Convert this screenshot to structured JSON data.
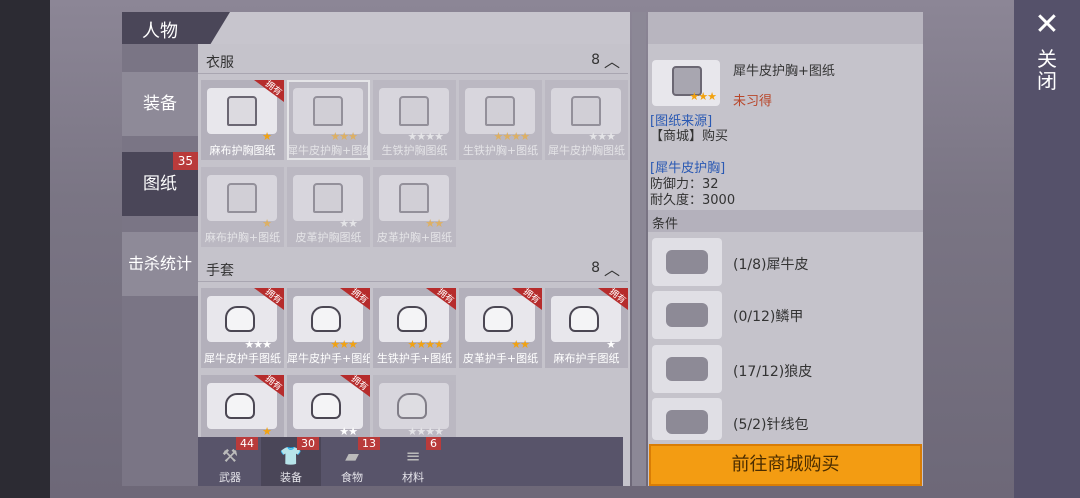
{
  "header": {
    "title": "人物"
  },
  "close": {
    "icon": "close-icon",
    "label": "关闭"
  },
  "sidebar": {
    "items": [
      {
        "label": "装备",
        "badge": ""
      },
      {
        "label": "图纸",
        "badge": "35"
      },
      {
        "label": "击杀统计",
        "badge": ""
      }
    ]
  },
  "sections": [
    {
      "title": "衣服",
      "count": "8"
    },
    {
      "title": "手套",
      "count": "8"
    }
  ],
  "owned_tag": "拥有",
  "clothes": [
    {
      "name": "麻布护胸图纸",
      "stars": 1,
      "max": 1,
      "owned": true,
      "dim": false,
      "selected": false
    },
    {
      "name": "犀牛皮护胸+图纸",
      "stars": 3,
      "max": 3,
      "owned": false,
      "dim": true,
      "selected": true
    },
    {
      "name": "生铁护胸图纸",
      "stars": 0,
      "max": 4,
      "owned": false,
      "dim": true,
      "selected": false
    },
    {
      "name": "生铁护胸+图纸",
      "stars": 4,
      "max": 4,
      "owned": false,
      "dim": true,
      "selected": false
    },
    {
      "name": "犀牛皮护胸图纸",
      "stars": 0,
      "max": 3,
      "owned": false,
      "dim": true,
      "selected": false
    },
    {
      "name": "麻布护胸+图纸",
      "stars": 1,
      "max": 1,
      "owned": false,
      "dim": true,
      "selected": false
    },
    {
      "name": "皮革护胸图纸",
      "stars": 0,
      "max": 2,
      "owned": false,
      "dim": true,
      "selected": false
    },
    {
      "name": "皮革护胸+图纸",
      "stars": 2,
      "max": 2,
      "owned": false,
      "dim": true,
      "selected": false
    }
  ],
  "gloves": [
    {
      "name": "犀牛皮护手图纸",
      "stars": 0,
      "max": 3,
      "owned": true,
      "dim": false
    },
    {
      "name": "犀牛皮护手+图纸",
      "stars": 3,
      "max": 3,
      "owned": true,
      "dim": false
    },
    {
      "name": "生铁护手+图纸",
      "stars": 4,
      "max": 4,
      "owned": true,
      "dim": false
    },
    {
      "name": "皮革护手+图纸",
      "stars": 2,
      "max": 2,
      "owned": true,
      "dim": false
    },
    {
      "name": "麻布护手图纸",
      "stars": 0,
      "max": 1,
      "owned": true,
      "dim": false
    },
    {
      "name": "",
      "stars": 1,
      "max": 1,
      "owned": true,
      "dim": false
    },
    {
      "name": "",
      "stars": 0,
      "max": 2,
      "owned": true,
      "dim": false
    },
    {
      "name": "",
      "stars": 0,
      "max": 4,
      "owned": false,
      "dim": true
    }
  ],
  "bottom_tabs": [
    {
      "label": "武器",
      "badge": "44",
      "icon": "axe-icon"
    },
    {
      "label": "装备",
      "badge": "30",
      "icon": "shirt-icon"
    },
    {
      "label": "食物",
      "badge": "13",
      "icon": "meat-icon"
    },
    {
      "label": "材料",
      "badge": "6",
      "icon": "wood-icon"
    }
  ],
  "detail": {
    "name": "犀牛皮护胸+图纸",
    "stars": 3,
    "status": "未习得",
    "source_title": "[图纸来源]",
    "source_value": "【商城】购买",
    "item_title": "[犀牛皮护胸]",
    "defense": "防御力：32",
    "durability": "耐久度：3000",
    "conditions_title": "条件",
    "materials": [
      {
        "text": "(1/8)犀牛皮",
        "met": false,
        "icon": "rhino-hide-icon"
      },
      {
        "text": "(0/12)鳞甲",
        "met": false,
        "icon": "scale-armor-icon"
      },
      {
        "text": "(17/12)狼皮",
        "met": true,
        "icon": "wolf-hide-icon"
      },
      {
        "text": "(5/2)针线包",
        "met": true,
        "icon": "sewing-kit-icon"
      }
    ],
    "buy_button": "前往商城购买"
  },
  "colors": {
    "accent": "#f39c12",
    "owned": "#b62c2c",
    "star": "#f2a20f",
    "unmet": "#b8462a",
    "link": "#2a59b3"
  }
}
